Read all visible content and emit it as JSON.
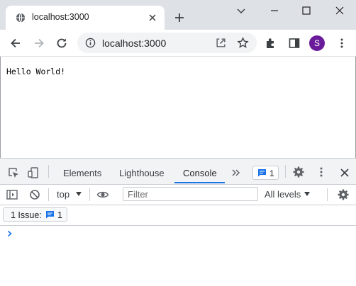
{
  "browser": {
    "tab": {
      "title": "localhost:3000",
      "favicon": "globe-icon"
    },
    "address": {
      "url": "localhost:3000"
    },
    "profile": {
      "initial": "S",
      "color": "#6a1b9a"
    }
  },
  "page": {
    "text": "Hello World!"
  },
  "devtools": {
    "tabs": [
      {
        "label": "Elements"
      },
      {
        "label": "Lighthouse"
      },
      {
        "label": "Console",
        "active": true
      }
    ],
    "message_count": "1",
    "console": {
      "context": "top",
      "filter_placeholder": "Filter",
      "filter_value": "",
      "levels": "All levels"
    },
    "issues": {
      "label": "1 Issue:",
      "count": "1"
    }
  },
  "colors": {
    "accent": "#1a73e8",
    "titlebar": "#dee1e6"
  }
}
